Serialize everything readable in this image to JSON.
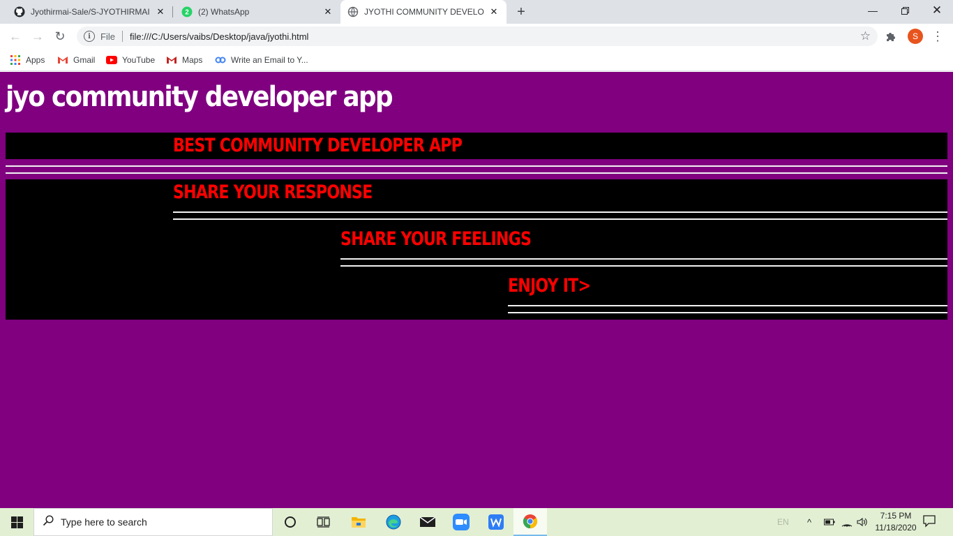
{
  "browser": {
    "tabs": [
      {
        "title": "Jyothirmai-Sale/S-JYOTHIRMAI",
        "icon": "github-icon",
        "active": false
      },
      {
        "title": "(2) WhatsApp",
        "icon": "whatsapp-icon",
        "badge": "2",
        "active": false
      },
      {
        "title": "JYOTHI COMMUNITY DEVELOPER",
        "icon": "globe-icon",
        "active": true
      }
    ],
    "new_tab": "+",
    "address": {
      "scheme_label": "File",
      "url": "file:///C:/Users/vaibs/Desktop/java/jyothi.html"
    },
    "profile_initial": "S",
    "bookmarks": [
      {
        "label": "Apps",
        "icon": "apps-grid-icon"
      },
      {
        "label": "Gmail",
        "icon": "gmail-icon"
      },
      {
        "label": "YouTube",
        "icon": "youtube-icon"
      },
      {
        "label": "Maps",
        "icon": "maps-icon"
      },
      {
        "label": "Write an Email to Y...",
        "icon": "link-icon"
      }
    ]
  },
  "page": {
    "heading": "jyo community developer app",
    "banner": "BEST COMMUNITY DEVELOPER APP",
    "items": [
      "SHARE YOUR RESPONSE",
      "SHARE YOUR FEELINGS",
      "ENJOY IT>"
    ],
    "colors": {
      "background": "#800080",
      "heading": "#ffffff",
      "accent": "#ff0000",
      "panel": "#000000"
    }
  },
  "taskbar": {
    "search_placeholder": "Type here to search",
    "language": "EN",
    "time": "7:15 PM",
    "date": "11/18/2020",
    "apps": [
      "cortana-icon",
      "task-view-icon",
      "file-explorer-icon",
      "edge-icon",
      "mail-icon",
      "zoom-icon",
      "wps-icon",
      "chrome-icon"
    ]
  }
}
